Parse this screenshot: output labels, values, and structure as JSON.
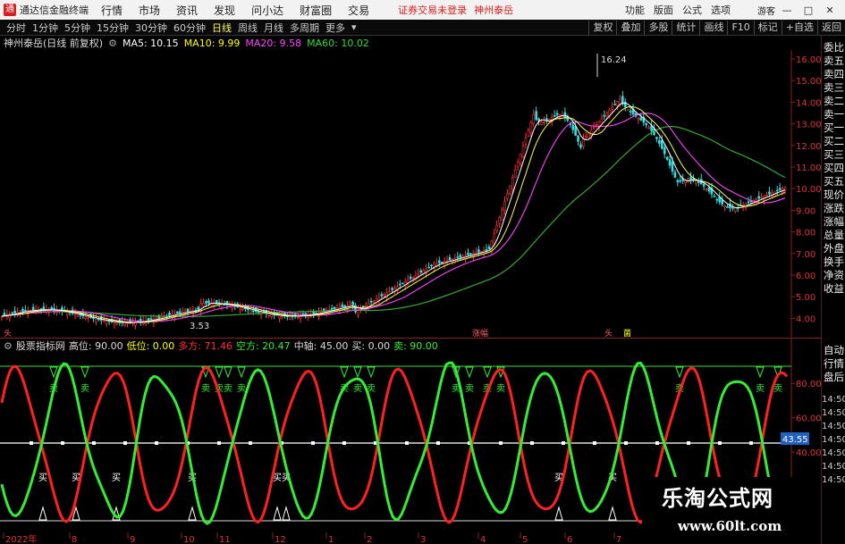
{
  "titlebar": {
    "app_name": "通达信金融终端",
    "menus": [
      "行情",
      "市场",
      "资讯",
      "发现",
      "问小达",
      "财富圈",
      "交易"
    ],
    "status": "证券交易未登录",
    "stock": "神州泰岳",
    "right_items": [
      "功能",
      "版面",
      "公式",
      "选项"
    ],
    "guest": "游客"
  },
  "periods": {
    "items": [
      "分时",
      "1分钟",
      "5分钟",
      "15分钟",
      "30分钟",
      "60分钟",
      "日线",
      "周线",
      "月线",
      "多周期",
      "更多"
    ],
    "active": "日线"
  },
  "tools": [
    "复权",
    "叠加",
    "多股",
    "统计",
    "画线",
    "F10",
    "标记",
    "+自选",
    "返回"
  ],
  "info": {
    "name": "神州泰岳(日线 前复权)",
    "ma": [
      {
        "label": "MA5: 10.15",
        "color": "#ffffff"
      },
      {
        "label": "MA10: 9.99",
        "color": "#ffff00"
      },
      {
        "label": "MA20: 9.58",
        "color": "#ff44ff"
      },
      {
        "label": "MA60: 10.02",
        "color": "#33dd33"
      }
    ]
  },
  "side_top": [
    "委比",
    "卖五",
    "卖四",
    "卖三",
    "卖二",
    "卖一",
    "买一",
    "买二",
    "买三",
    "买四",
    "买五",
    "现价",
    "涨跌",
    "涨幅",
    "总量",
    "外盘",
    "换手",
    "净资",
    "收益"
  ],
  "side_mid": [
    "自动",
    "行情",
    "盘后"
  ],
  "side_times": [
    "14:50",
    "14:50",
    "14:50",
    "14:50",
    "14:50",
    "14:50",
    "14:50"
  ],
  "price_axis": [
    "16.00",
    "15.00",
    "14.00",
    "13.00",
    "12.00",
    "11.00",
    "10.00",
    "9.00",
    "8.00",
    "7.00",
    "6.00",
    "5.00",
    "4.00"
  ],
  "price_marks": {
    "high": "16.24",
    "low": "3.53",
    "tag1": "涨幅",
    "tag2": "头",
    "tag3": "菌",
    "tag4": "头"
  },
  "indicator": {
    "name": "股票指标网",
    "fields": [
      {
        "label": "高位: 90.00",
        "color": "#dddddd"
      },
      {
        "label": "低位: 0.00",
        "color": "#ffff00"
      },
      {
        "label": "多方: 71.46",
        "color": "#ff3030"
      },
      {
        "label": "空方: 20.47",
        "color": "#33ee33"
      },
      {
        "label": "中轴: 45.00",
        "color": "#dddddd"
      },
      {
        "label": "买: 0.00",
        "color": "#dddddd"
      },
      {
        "label": "卖: 90.00",
        "color": "#33ee33"
      }
    ],
    "axis": [
      "80.00",
      "60.00",
      "43.55",
      "40.00",
      "20.00"
    ],
    "sell_label": "卖",
    "buy_label": "买"
  },
  "date_axis": [
    "2022年",
    "8",
    "9",
    "10",
    "11",
    "12",
    "1",
    "2",
    "3",
    "4",
    "5",
    "6",
    "7"
  ],
  "watermark": {
    "title": "乐淘公式网",
    "url": "www.60lt.com"
  },
  "colors": {
    "up": "#ff3030",
    "down": "#33dd33",
    "ma5": "#ffffff",
    "ma10": "#ffff00",
    "ma20": "#ff44ff",
    "ma60": "#33aa33"
  }
}
